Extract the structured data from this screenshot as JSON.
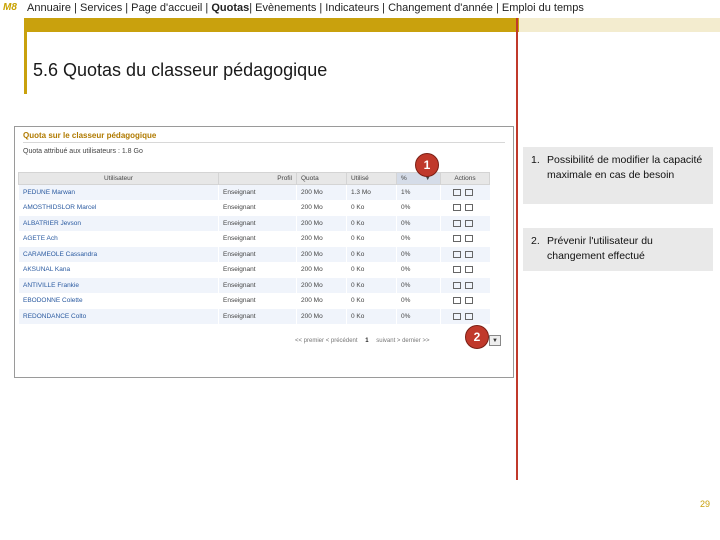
{
  "header": {
    "logo": "M8",
    "nav": [
      {
        "label": "Annuaire |",
        "active": false
      },
      {
        "label": "Services | Page d'accueil |",
        "active": false
      },
      {
        "label": "Quotas",
        "active": true
      },
      {
        "label": "| Evènements | Indicateurs |",
        "active": false
      },
      {
        "label": "Changement d'année",
        "active": false
      },
      {
        "label": "| Emploi du temps",
        "active": false
      }
    ]
  },
  "slide": {
    "title": "5.6  Quotas du classeur pédagogique",
    "page_number": "29"
  },
  "screenshot": {
    "panel_title": "Quota sur le classeur pédagogique",
    "quota_info": "Quota attribué aux utilisateurs : 1.8 Go",
    "columns": [
      "Utilisateur",
      "Profil",
      "Quota",
      "Utilisé",
      "%",
      "Actions"
    ],
    "rows": [
      {
        "name": "PEDUNE Marwan",
        "profile": "Enseignant",
        "quota": "200 Mo",
        "used": "1.3 Mo",
        "percent": "1%"
      },
      {
        "name": "AMOSTHIDSLOR Marcel",
        "profile": "Enseignant",
        "quota": "200 Mo",
        "used": "0 Ko",
        "percent": "0%"
      },
      {
        "name": "ALBATRIER Jevson",
        "profile": "Enseignant",
        "quota": "200 Mo",
        "used": "0 Ko",
        "percent": "0%"
      },
      {
        "name": "AGETE Ach",
        "profile": "Enseignant",
        "quota": "200 Mo",
        "used": "0 Ko",
        "percent": "0%"
      },
      {
        "name": "CARAMEOLE Cassandra",
        "profile": "Enseignant",
        "quota": "200 Mo",
        "used": "0 Ko",
        "percent": "0%"
      },
      {
        "name": "AKSUNAL Kana",
        "profile": "Enseignant",
        "quota": "200 Mo",
        "used": "0 Ko",
        "percent": "0%"
      },
      {
        "name": "ANTIVILLE Frankie",
        "profile": "Enseignant",
        "quota": "200 Mo",
        "used": "0 Ko",
        "percent": "0%"
      },
      {
        "name": "EBODONNE Colette",
        "profile": "Enseignant",
        "quota": "200 Mo",
        "used": "0 Ko",
        "percent": "0%"
      },
      {
        "name": "REDONDANCE Colto",
        "profile": "Enseignant",
        "quota": "200 Mo",
        "used": "0 Ko",
        "percent": "0%"
      }
    ],
    "pager": {
      "first": "<< premier",
      "previous": "< précédent",
      "current": "1",
      "next": "suivant >",
      "last": "dernier >>"
    },
    "badges": [
      "1",
      "2"
    ]
  },
  "notes": [
    {
      "number": "1.",
      "text": "Possibilité de modifier la capacité maximale en cas de besoin"
    },
    {
      "number": "2.",
      "text": "Prévenir l'utilisateur du changement effectué"
    }
  ],
  "colors": {
    "accent": "#c9a10d",
    "rule": "#c0392b",
    "badge": "#c0392b"
  }
}
